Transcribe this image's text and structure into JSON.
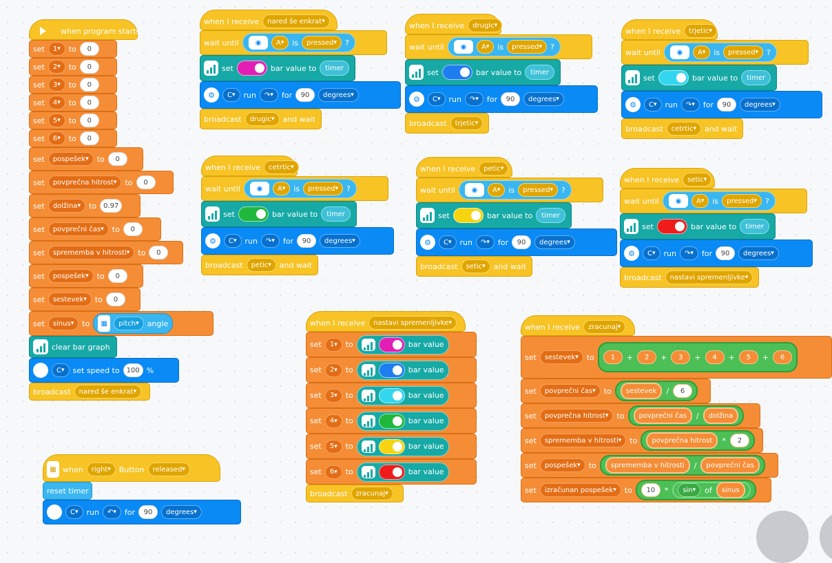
{
  "colors": {
    "events": "#f7c325",
    "variables": "#f58d36",
    "display": "#17a9a6",
    "motors": "#0a8af5",
    "sensors": "#3ab6f0",
    "operators": "#4cbf56"
  },
  "main": {
    "when_program_starts": "when program starts",
    "set": "set",
    "to": "to",
    "vars": [
      {
        "name": "1",
        "value": "0"
      },
      {
        "name": "2",
        "value": "0"
      },
      {
        "name": "3",
        "value": "0"
      },
      {
        "name": "4",
        "value": "0"
      },
      {
        "name": "5",
        "value": "0"
      },
      {
        "name": "6",
        "value": "0"
      },
      {
        "name": "pospešek",
        "value": "0"
      },
      {
        "name": "povprečna hitrost",
        "value": "0"
      },
      {
        "name": "dolžina",
        "value": "0.97"
      },
      {
        "name": "povprečni čas",
        "value": "0"
      },
      {
        "name": "sprememba v hitrosti",
        "value": "0"
      },
      {
        "name": "pospešek",
        "value": "0"
      },
      {
        "name": "sestevek",
        "value": "0"
      }
    ],
    "sinus_name": "sinus",
    "pitch": "pitch",
    "angle": "angle",
    "clear_bar_graph": "clear bar graph",
    "motor_port": "C",
    "set_speed_to": "set speed to",
    "speed": "100",
    "percent": "%",
    "broadcast": "broadcast",
    "broadcast_msg": "nared še enkrat",
    "and_wait": "and wait"
  },
  "button_stack": {
    "when": "when",
    "right": "right",
    "button": "Button",
    "released": "released",
    "reset_timer": "reset timer",
    "motor": "C",
    "run": "run",
    "for": "for",
    "deg": "90",
    "degrees": "degrees"
  },
  "common": {
    "when_i_receive": "when I receive",
    "wait_until": "wait until",
    "sensor_port": "A",
    "is": "is",
    "pressed": "pressed",
    "q": "?",
    "set": "set",
    "bar_value_to": "bar value to",
    "timer": "timer",
    "motor": "C",
    "run": "run",
    "for": "for",
    "deg": "90",
    "degrees": "degrees",
    "broadcast": "broadcast",
    "and_wait": "and wait",
    "bar_value": "bar value"
  },
  "receivers": [
    {
      "msg": "nared še enkrat",
      "color": "#e21fb5",
      "next": "drugic",
      "wait": true
    },
    {
      "msg": "drugic",
      "color": "#1e7df0",
      "next": "trjetic",
      "wait": false
    },
    {
      "msg": "trjetic",
      "color": "#33d6ef",
      "next": "cetrtic",
      "wait": true
    },
    {
      "msg": "cetrtic",
      "color": "#1fb83d",
      "next": "petic",
      "wait": true
    },
    {
      "msg": "petic",
      "color": "#f6d40f",
      "next": "setic",
      "wait": true
    },
    {
      "msg": "setic",
      "color": "#f01b1b",
      "next": "nastavi spremenljivke",
      "wait": false
    }
  ],
  "nastavi": {
    "msg": "nastavi spremenljivke",
    "rows": [
      {
        "var": "1",
        "color": "#e21fb5"
      },
      {
        "var": "2",
        "color": "#1e7df0"
      },
      {
        "var": "3",
        "color": "#33d6ef"
      },
      {
        "var": "4",
        "color": "#1fb83d"
      },
      {
        "var": "5",
        "color": "#f6d40f"
      },
      {
        "var": "6",
        "color": "#f01b1b"
      }
    ],
    "broadcast_msg": "zracunaj"
  },
  "zracunaj": {
    "msg": "zracunaj",
    "sum_var": "sestevek",
    "terms": [
      "1",
      "2",
      "3",
      "4",
      "5",
      "6"
    ],
    "plus": "+",
    "avg_time_var": "povprečni čas",
    "div": "/",
    "six": "6",
    "avg_speed_var": "povprečna hitrost",
    "len_var": "dolžina",
    "delta_v_var": "sprememba v hitrosti",
    "mul": "*",
    "two": "2",
    "acc_var": "pospešek",
    "calc_acc_var": "izračunan pospešek",
    "ten": "10",
    "sin": "sin",
    "of": "of",
    "sinus": "sinus"
  }
}
